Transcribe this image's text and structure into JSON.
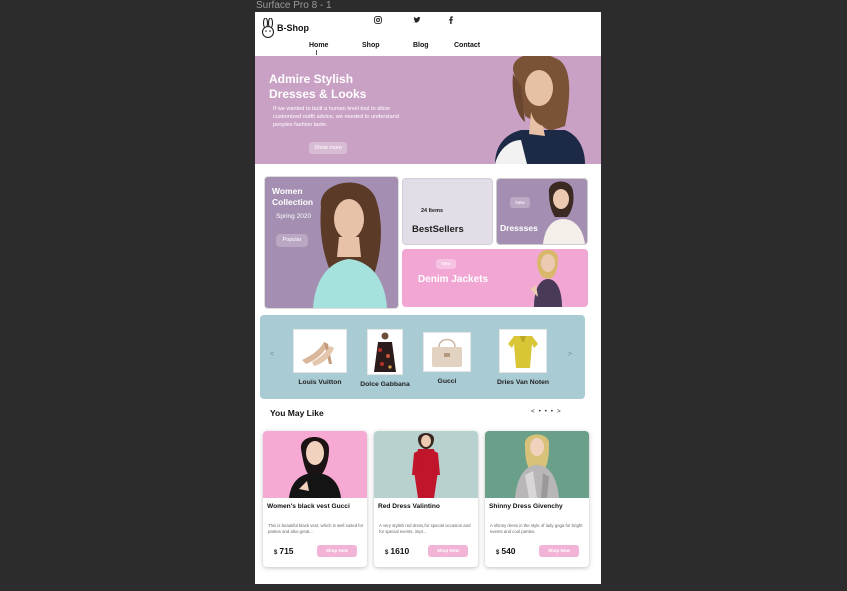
{
  "canvas": {
    "label": "Surface Pro 8 - 1"
  },
  "header": {
    "brand": "B-Shop",
    "nav": [
      "Home",
      "Shop",
      "Blog",
      "Contact"
    ],
    "social": [
      "instagram-icon",
      "twitter-icon",
      "facebook-icon"
    ]
  },
  "hero": {
    "title_line1": "Admire Stylish",
    "title_line2": "Dresses & Looks",
    "description": "If we wanted  to built a human level tool to allow customized outfit advice, we needed to understand peoples fashion taste.",
    "button": "Show more"
  },
  "collections": {
    "women": {
      "line1": "Women",
      "line2": "Collection",
      "sub": "Spring 2020",
      "button": "Popular"
    },
    "bestsellers": {
      "count": "24 Items",
      "title": "BestSellers"
    },
    "dresses": {
      "badge": "New",
      "title": "Dressses"
    },
    "denim": {
      "badge": "New",
      "title": "Denim Jackets"
    }
  },
  "brands": {
    "prev": "<",
    "next": ">",
    "items": [
      "Louis Vuitton",
      "Dolce Gabbana",
      "Gucci",
      "Dries Van Noten"
    ]
  },
  "you_may_like": {
    "title": "You May Like",
    "pager": "< • • • >",
    "products": [
      {
        "name": "Women's black vest Gucci",
        "desc": "This is beautiful black vest, which is well suited for parties and also great...",
        "currency": "$",
        "price": "715",
        "button": "Shop Now",
        "bg": "#f6a9d2"
      },
      {
        "name": "Red Dress Valintino",
        "desc": "A very stylish red dress,for special occasion and for special events, impr...",
        "currency": "$",
        "price": "1610",
        "button": "Shop Now",
        "bg": "#b7d1cf"
      },
      {
        "name": "Shinny Dress Givenchy",
        "desc": "A shinny dress in the style of lady goga for bright events and cool parties.",
        "currency": "$",
        "price": "540",
        "button": "Shop Now",
        "bg": "#6aa08a"
      }
    ]
  },
  "colors": {
    "hero": "#c9a1c4",
    "women": "#a48fb2",
    "denim": "#f1a6d3",
    "brands": "#a9cbd4",
    "button": "#f1b4d6"
  }
}
